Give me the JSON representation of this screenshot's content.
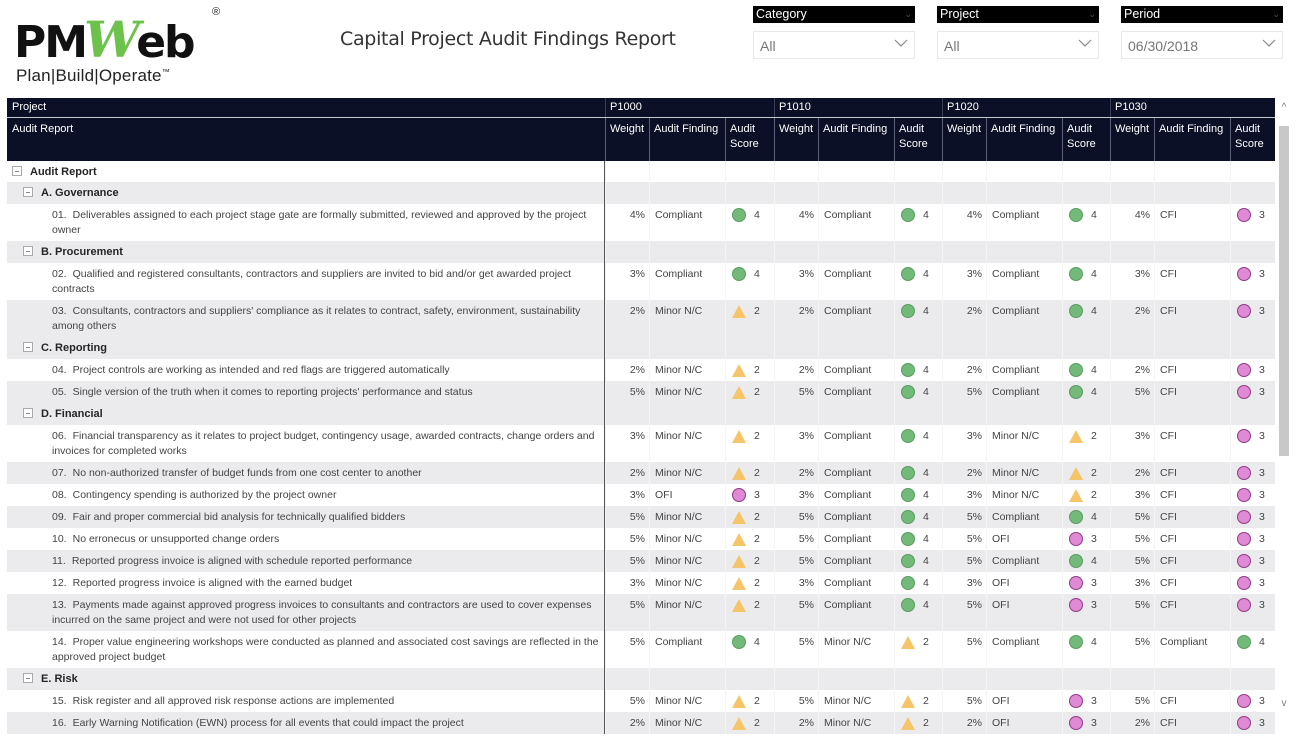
{
  "logo": {
    "text_left": "PM",
    "text_w": "W",
    "text_right": "eb",
    "registered": "®",
    "tagline": "Plan|Build|Operate",
    "tm": "™"
  },
  "report_title": "Capital Project Audit Findings Report",
  "slicers": [
    {
      "label": "Category",
      "value": "All"
    },
    {
      "label": "Project",
      "value": "All"
    },
    {
      "label": "Period",
      "value": "06/30/2018"
    }
  ],
  "colors": {
    "header_bg": "#0c1026",
    "compliant": "#72b97a",
    "minor_nc": "#f6c56a",
    "ofi": "#e08ad6",
    "row_alt": "#ebebee"
  },
  "table": {
    "row_header_1": "Project",
    "row_header_2": "Audit Report",
    "projects": [
      "P1000",
      "P1010",
      "P1020",
      "P1030"
    ],
    "sub_headers": {
      "weight": "Weight",
      "finding": "Audit Finding",
      "score_line1": "Audit",
      "score_line2": "Score"
    },
    "root_label": "Audit Report",
    "groups": [
      {
        "title": "A. Governance",
        "items": [
          {
            "num": "01.",
            "text": "Deliverables assigned to each project stage gate are formally submitted, reviewed and approved by the project owner",
            "cells": [
              {
                "w": "4%",
                "f": "Compliant",
                "icon": "circle-green",
                "s": "4"
              },
              {
                "w": "4%",
                "f": "Compliant",
                "icon": "circle-green",
                "s": "4"
              },
              {
                "w": "4%",
                "f": "Compliant",
                "icon": "circle-green",
                "s": "4"
              },
              {
                "w": "4%",
                "f": "CFI",
                "icon": "circle-pink",
                "s": "3"
              }
            ]
          }
        ]
      },
      {
        "title": "B. Procurement",
        "items": [
          {
            "num": "02.",
            "text": "Qualified and registered consultants, contractors and suppliers are invited to bid and/or get awarded project contracts",
            "cells": [
              {
                "w": "3%",
                "f": "Compliant",
                "icon": "circle-green",
                "s": "4"
              },
              {
                "w": "3%",
                "f": "Compliant",
                "icon": "circle-green",
                "s": "4"
              },
              {
                "w": "3%",
                "f": "Compliant",
                "icon": "circle-green",
                "s": "4"
              },
              {
                "w": "3%",
                "f": "CFI",
                "icon": "circle-pink",
                "s": "3"
              }
            ]
          },
          {
            "num": "03.",
            "text": "Consultants, contractors and suppliers' compliance as it relates to contract, safety, environment, sustainability among others",
            "cells": [
              {
                "w": "2%",
                "f": "Minor N/C",
                "icon": "triangle",
                "s": "2"
              },
              {
                "w": "2%",
                "f": "Compliant",
                "icon": "circle-green",
                "s": "4"
              },
              {
                "w": "2%",
                "f": "Compliant",
                "icon": "circle-green",
                "s": "4"
              },
              {
                "w": "2%",
                "f": "CFI",
                "icon": "circle-pink",
                "s": "3"
              }
            ]
          }
        ]
      },
      {
        "title": "C. Reporting",
        "items": [
          {
            "num": "04.",
            "text": "Project controls are working as intended and red flags are triggered automatically",
            "cells": [
              {
                "w": "2%",
                "f": "Minor N/C",
                "icon": "triangle",
                "s": "2"
              },
              {
                "w": "2%",
                "f": "Compliant",
                "icon": "circle-green",
                "s": "4"
              },
              {
                "w": "2%",
                "f": "Compliant",
                "icon": "circle-green",
                "s": "4"
              },
              {
                "w": "2%",
                "f": "CFI",
                "icon": "circle-pink",
                "s": "3"
              }
            ]
          },
          {
            "num": "05.",
            "text": "Single version of the truth when it comes to reporting projects' performance and status",
            "cells": [
              {
                "w": "5%",
                "f": "Minor N/C",
                "icon": "triangle",
                "s": "2"
              },
              {
                "w": "5%",
                "f": "Compliant",
                "icon": "circle-green",
                "s": "4"
              },
              {
                "w": "5%",
                "f": "Compliant",
                "icon": "circle-green",
                "s": "4"
              },
              {
                "w": "5%",
                "f": "CFI",
                "icon": "circle-pink",
                "s": "3"
              }
            ]
          }
        ]
      },
      {
        "title": "D. Financial",
        "items": [
          {
            "num": "06.",
            "text": "Financial transparency as it relates to project budget, contingency usage, awarded contracts, change orders and invoices for completed works",
            "cells": [
              {
                "w": "3%",
                "f": "Minor N/C",
                "icon": "triangle",
                "s": "2"
              },
              {
                "w": "3%",
                "f": "Compliant",
                "icon": "circle-green",
                "s": "4"
              },
              {
                "w": "3%",
                "f": "Minor N/C",
                "icon": "triangle",
                "s": "2"
              },
              {
                "w": "3%",
                "f": "CFI",
                "icon": "circle-pink",
                "s": "3"
              }
            ]
          },
          {
            "num": "07.",
            "text": "No non-authorized transfer of budget funds from one cost center to another",
            "cells": [
              {
                "w": "2%",
                "f": "Minor N/C",
                "icon": "triangle",
                "s": "2"
              },
              {
                "w": "2%",
                "f": "Compliant",
                "icon": "circle-green",
                "s": "4"
              },
              {
                "w": "2%",
                "f": "Minor N/C",
                "icon": "triangle",
                "s": "2"
              },
              {
                "w": "2%",
                "f": "CFI",
                "icon": "circle-pink",
                "s": "3"
              }
            ]
          },
          {
            "num": "08.",
            "text": "Contingency spending is authorized by the project owner",
            "cells": [
              {
                "w": "3%",
                "f": "OFI",
                "icon": "circle-pink",
                "s": "3"
              },
              {
                "w": "3%",
                "f": "Compliant",
                "icon": "circle-green",
                "s": "4"
              },
              {
                "w": "3%",
                "f": "Minor N/C",
                "icon": "triangle",
                "s": "2"
              },
              {
                "w": "3%",
                "f": "CFI",
                "icon": "circle-pink",
                "s": "3"
              }
            ]
          },
          {
            "num": "09.",
            "text": "Fair and proper commercial bid analysis for technically qualified bidders",
            "cells": [
              {
                "w": "5%",
                "f": "Minor N/C",
                "icon": "triangle",
                "s": "2"
              },
              {
                "w": "5%",
                "f": "Compliant",
                "icon": "circle-green",
                "s": "4"
              },
              {
                "w": "5%",
                "f": "Compliant",
                "icon": "circle-green",
                "s": "4"
              },
              {
                "w": "5%",
                "f": "CFI",
                "icon": "circle-pink",
                "s": "3"
              }
            ]
          },
          {
            "num": "10.",
            "text": "No erronecus or unsupported change orders",
            "cells": [
              {
                "w": "5%",
                "f": "Minor N/C",
                "icon": "triangle",
                "s": "2"
              },
              {
                "w": "5%",
                "f": "Compliant",
                "icon": "circle-green",
                "s": "4"
              },
              {
                "w": "5%",
                "f": "OFI",
                "icon": "circle-pink",
                "s": "3"
              },
              {
                "w": "5%",
                "f": "CFI",
                "icon": "circle-pink",
                "s": "3"
              }
            ]
          },
          {
            "num": "11.",
            "text": "Reported progress invoice is aligned with schedule reported performance",
            "cells": [
              {
                "w": "5%",
                "f": "Minor N/C",
                "icon": "triangle",
                "s": "2"
              },
              {
                "w": "5%",
                "f": "Compliant",
                "icon": "circle-green",
                "s": "4"
              },
              {
                "w": "5%",
                "f": "Compliant",
                "icon": "circle-green",
                "s": "4"
              },
              {
                "w": "5%",
                "f": "CFI",
                "icon": "circle-pink",
                "s": "3"
              }
            ]
          },
          {
            "num": "12.",
            "text": "Reported progress invoice is aligned with the earned budget",
            "cells": [
              {
                "w": "3%",
                "f": "Minor N/C",
                "icon": "triangle",
                "s": "2"
              },
              {
                "w": "3%",
                "f": "Compliant",
                "icon": "circle-green",
                "s": "4"
              },
              {
                "w": "3%",
                "f": "OFI",
                "icon": "circle-pink",
                "s": "3"
              },
              {
                "w": "3%",
                "f": "CFI",
                "icon": "circle-pink",
                "s": "3"
              }
            ]
          },
          {
            "num": "13.",
            "text": "Payments made against approved progress invoices to consultants and contractors are used to cover expenses incurred on the same project and were not used for other projects",
            "cells": [
              {
                "w": "5%",
                "f": "Minor N/C",
                "icon": "triangle",
                "s": "2"
              },
              {
                "w": "5%",
                "f": "Compliant",
                "icon": "circle-green",
                "s": "4"
              },
              {
                "w": "5%",
                "f": "OFI",
                "icon": "circle-pink",
                "s": "3"
              },
              {
                "w": "5%",
                "f": "CFI",
                "icon": "circle-pink",
                "s": "3"
              }
            ]
          },
          {
            "num": "14.",
            "text": "Proper value engineering workshops were conducted as planned and associated cost savings are reflected in the approved project budget",
            "cells": [
              {
                "w": "5%",
                "f": "Compliant",
                "icon": "circle-green",
                "s": "4"
              },
              {
                "w": "5%",
                "f": "Minor N/C",
                "icon": "triangle",
                "s": "2"
              },
              {
                "w": "5%",
                "f": "Compliant",
                "icon": "circle-green",
                "s": "4"
              },
              {
                "w": "5%",
                "f": "Compliant",
                "icon": "circle-green",
                "s": "4"
              }
            ]
          }
        ]
      },
      {
        "title": "E. Risk",
        "items": [
          {
            "num": "15.",
            "text": "Risk register and all approved risk response actions are implemented",
            "cells": [
              {
                "w": "5%",
                "f": "Minor N/C",
                "icon": "triangle",
                "s": "2"
              },
              {
                "w": "5%",
                "f": "Minor N/C",
                "icon": "triangle",
                "s": "2"
              },
              {
                "w": "5%",
                "f": "OFI",
                "icon": "circle-pink",
                "s": "3"
              },
              {
                "w": "5%",
                "f": "CFI",
                "icon": "circle-pink",
                "s": "3"
              }
            ]
          },
          {
            "num": "16.",
            "text": "Early Warning Notification (EWN) process for all events that could impact the project",
            "cells": [
              {
                "w": "2%",
                "f": "Minor N/C",
                "icon": "triangle",
                "s": "2"
              },
              {
                "w": "2%",
                "f": "Minor N/C",
                "icon": "triangle",
                "s": "2"
              },
              {
                "w": "2%",
                "f": "OFI",
                "icon": "circle-pink",
                "s": "3"
              },
              {
                "w": "2%",
                "f": "CFI",
                "icon": "circle-pink",
                "s": "3"
              }
            ]
          }
        ]
      }
    ]
  },
  "scrollbar": {
    "up_icon": "^",
    "down_icon": "v"
  }
}
